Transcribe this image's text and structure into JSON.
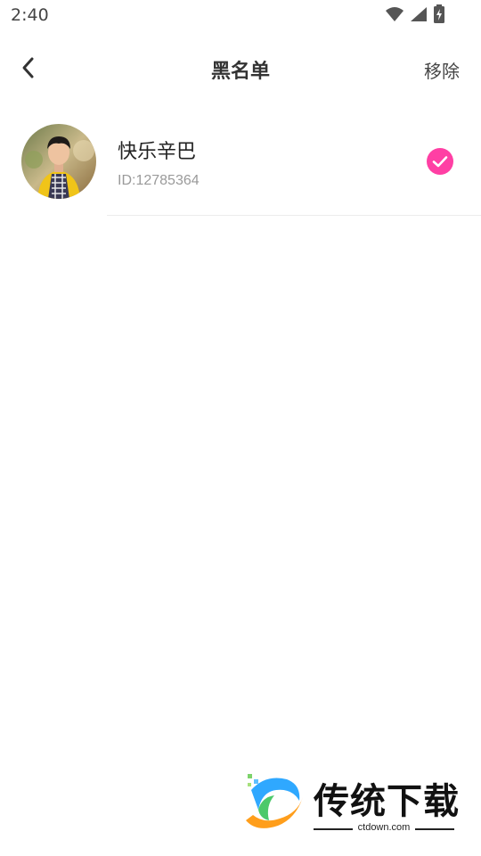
{
  "status_bar": {
    "time": "2:40",
    "icons": [
      "wifi-icon",
      "signal-icon",
      "battery-charging-icon"
    ]
  },
  "header": {
    "title": "黑名单",
    "back_icon": "chevron-left-icon",
    "remove_label": "移除"
  },
  "blacklist": {
    "items": [
      {
        "name": "快乐辛巴",
        "id_text": "ID:12785364",
        "selected": true,
        "avatar_icon": "user-avatar-photo"
      }
    ]
  },
  "colors": {
    "accent": "#ff3fa4",
    "text_primary": "#222222",
    "text_secondary": "#9a9a9a",
    "divider": "#ececec"
  },
  "watermark": {
    "name": "传统下载",
    "domain": "ctdown.com"
  }
}
